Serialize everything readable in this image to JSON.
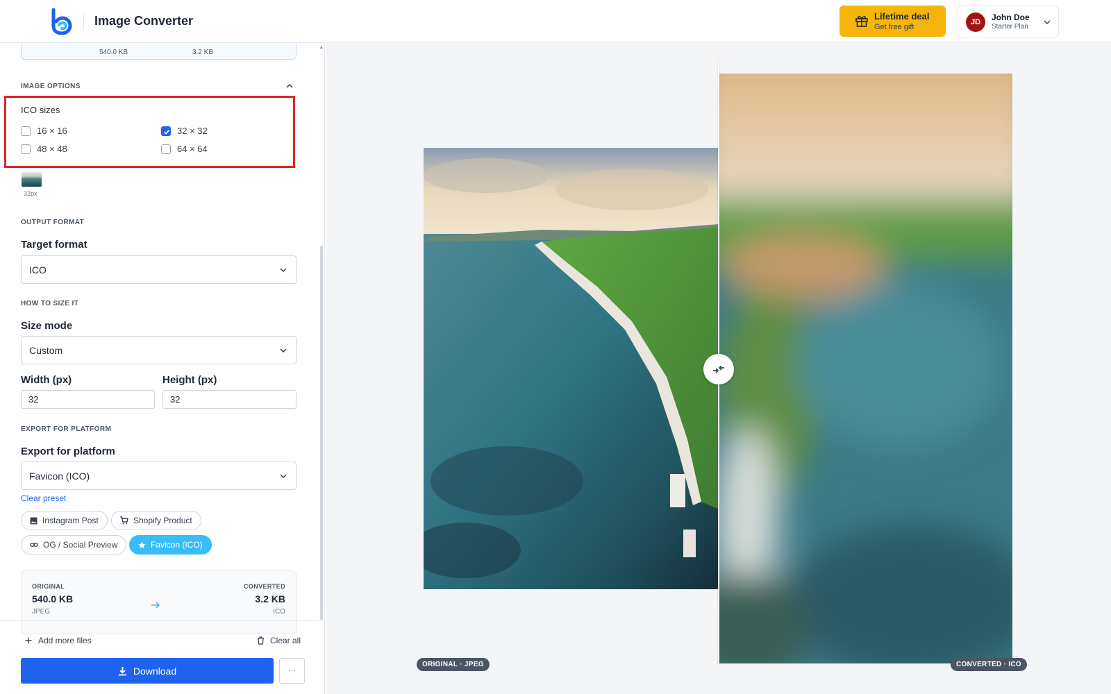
{
  "header": {
    "app_title": "Image Converter",
    "deal": {
      "title": "Lifetime deal",
      "subtitle": "Get free gift"
    },
    "user": {
      "initials": "JD",
      "name": "John Doe",
      "plan": "Starter Plan"
    }
  },
  "sidebar": {
    "prev_card": {
      "original_size": "540.0 KB",
      "converted_size": "3.2 KB"
    },
    "image_options": {
      "section_label": "IMAGE OPTIONS",
      "ico_title": "ICO sizes",
      "sizes": [
        {
          "label": "16 × 16",
          "checked": false
        },
        {
          "label": "32 × 32",
          "checked": true
        },
        {
          "label": "48 × 48",
          "checked": false
        },
        {
          "label": "64 × 64",
          "checked": false
        }
      ],
      "thumb_label": "32px"
    },
    "output_format": {
      "section_label": "OUTPUT FORMAT",
      "field_title": "Target format",
      "value": "ICO"
    },
    "sizing": {
      "section_label": "HOW TO SIZE IT",
      "field_title": "Size mode",
      "value": "Custom",
      "width_label": "Width (px)",
      "width_value": "32",
      "height_label": "Height (px)",
      "height_value": "32"
    },
    "platform": {
      "section_label": "EXPORT FOR PLATFORM",
      "field_title": "Export for platform",
      "value": "Favicon (ICO)",
      "clear_preset": "Clear preset",
      "presets": [
        {
          "label": "Instagram Post",
          "icon": "image-icon",
          "active": false
        },
        {
          "label": "Shopify Product",
          "icon": "cart-icon",
          "active": false
        },
        {
          "label": "OG / Social Preview",
          "icon": "link-icon",
          "active": false
        },
        {
          "label": "Favicon (ICO)",
          "icon": "star-icon",
          "active": true
        }
      ]
    },
    "stats": {
      "original_label": "ORIGINAL",
      "original_size": "540.0 KB",
      "original_format": "JPEG",
      "converted_label": "CONVERTED",
      "converted_size": "3.2 KB",
      "converted_format": "ICO"
    },
    "footer": {
      "add_files": "Add more files",
      "clear_all": "Clear all",
      "download": "Download",
      "more": "···"
    }
  },
  "preview": {
    "original_badge": "ORIGINAL · JPEG",
    "converted_badge": "CONVERTED · ICO"
  },
  "colors": {
    "accent": "#1d63ed",
    "deal": "#f5b50a",
    "chip_active": "#38bdf8",
    "highlight": "#dc2626",
    "avatar": "#a01414"
  }
}
